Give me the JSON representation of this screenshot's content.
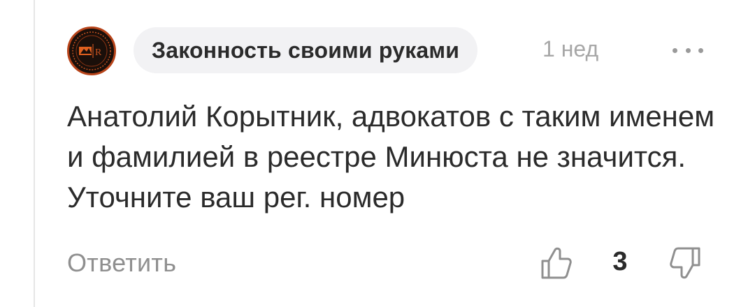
{
  "comment": {
    "author": "Законность своими руками",
    "time": "1 нед",
    "text": "Анатолий Корытник, адвокатов с таким именем и фамилией в реестре Минюста не значится. Уточните ваш рег. номер",
    "reply_label": "Ответить",
    "like_count": "3",
    "avatar_monogram": "R"
  },
  "icons": {
    "more": "more-horizontal-icon",
    "like": "thumbs-up-icon",
    "dislike": "thumbs-down-icon"
  },
  "colors": {
    "text": "#2b2b2b",
    "muted": "#a7a7a7",
    "chip_bg": "#f2f2f4",
    "avatar_accent": "#b8441a"
  }
}
